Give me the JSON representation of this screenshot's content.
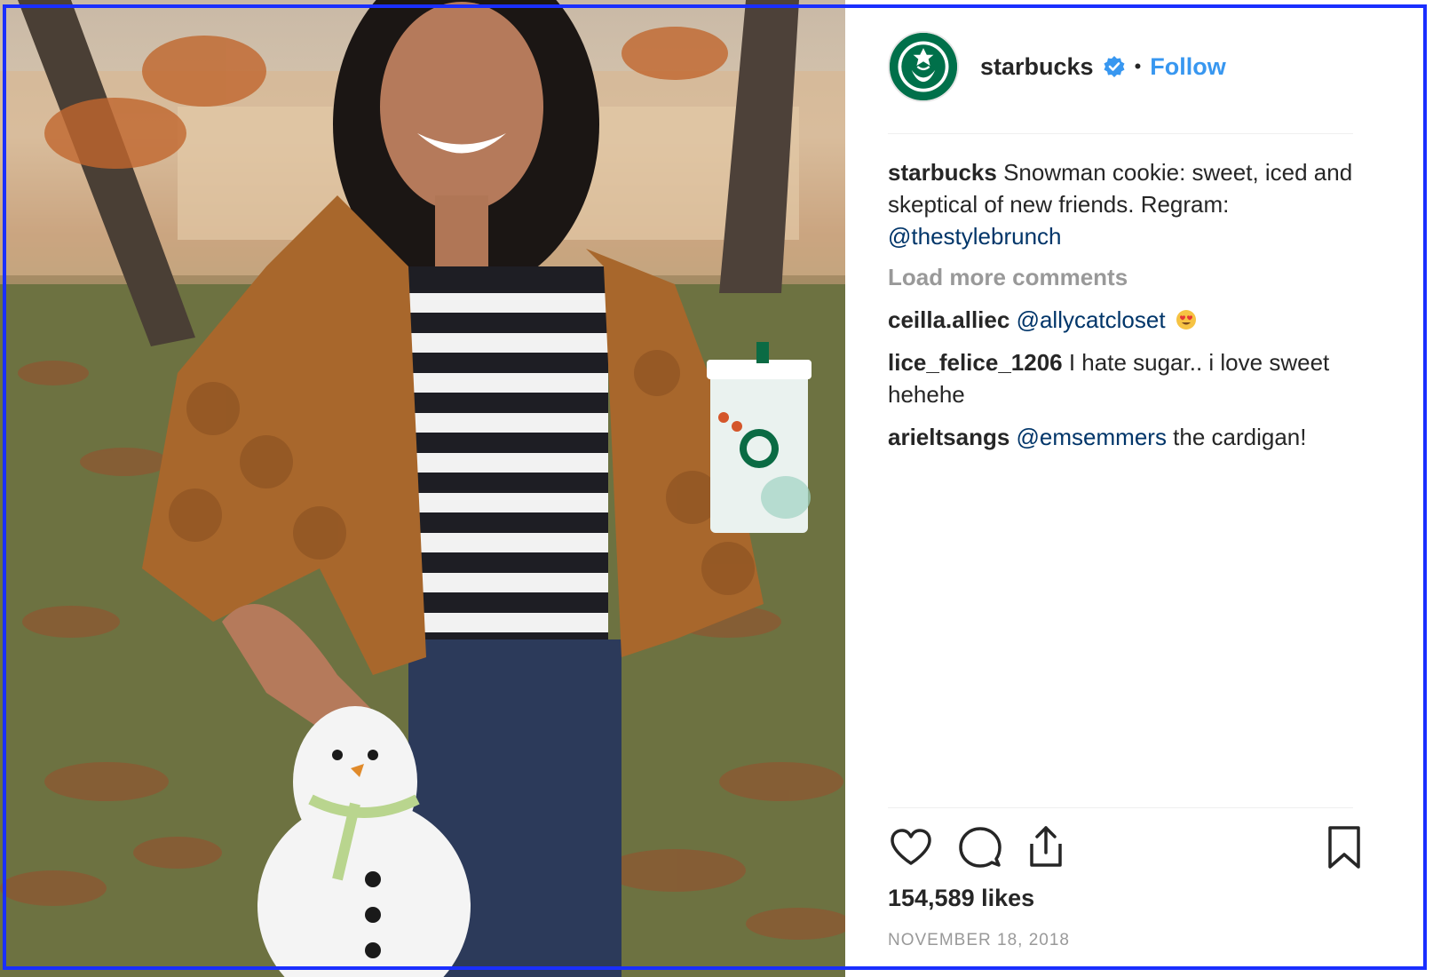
{
  "post": {
    "image_alt": "Woman in orange knit cardigan holding a snowman cookie and a Starbucks cup in an autumn park"
  },
  "header": {
    "avatar_icon": "starbucks-logo-icon",
    "username": "starbucks",
    "verified_icon": "verified-badge-icon",
    "separator": "•",
    "follow_label": "Follow"
  },
  "caption": {
    "username": "starbucks",
    "text": "Snowman cookie: sweet, iced and skeptical of new friends. Regram: ",
    "mention": "@thestylebrunch"
  },
  "load_more": "Load more comments",
  "comments": [
    {
      "username": "ceilla.alliec",
      "mention": "@allycatcloset",
      "text": "",
      "emoji": "heart-eyes-emoji"
    },
    {
      "username": "lice_felice_1206",
      "mention": "",
      "text": "I hate sugar.. i love sweet hehehe",
      "emoji": ""
    },
    {
      "username": "arieltsangs",
      "mention": "@emsemmers",
      "text": " the cardigan!",
      "emoji": ""
    }
  ],
  "actions": {
    "like_icon": "heart-icon",
    "comment_icon": "comment-icon",
    "share_icon": "share-icon",
    "save_icon": "bookmark-icon"
  },
  "likes": "154,589 likes",
  "date": "NOVEMBER 18, 2018",
  "colors": {
    "link": "#3897f0",
    "mention": "#003569",
    "muted": "#999999",
    "brand_green": "#00704a",
    "frame": "#1a2fff"
  }
}
